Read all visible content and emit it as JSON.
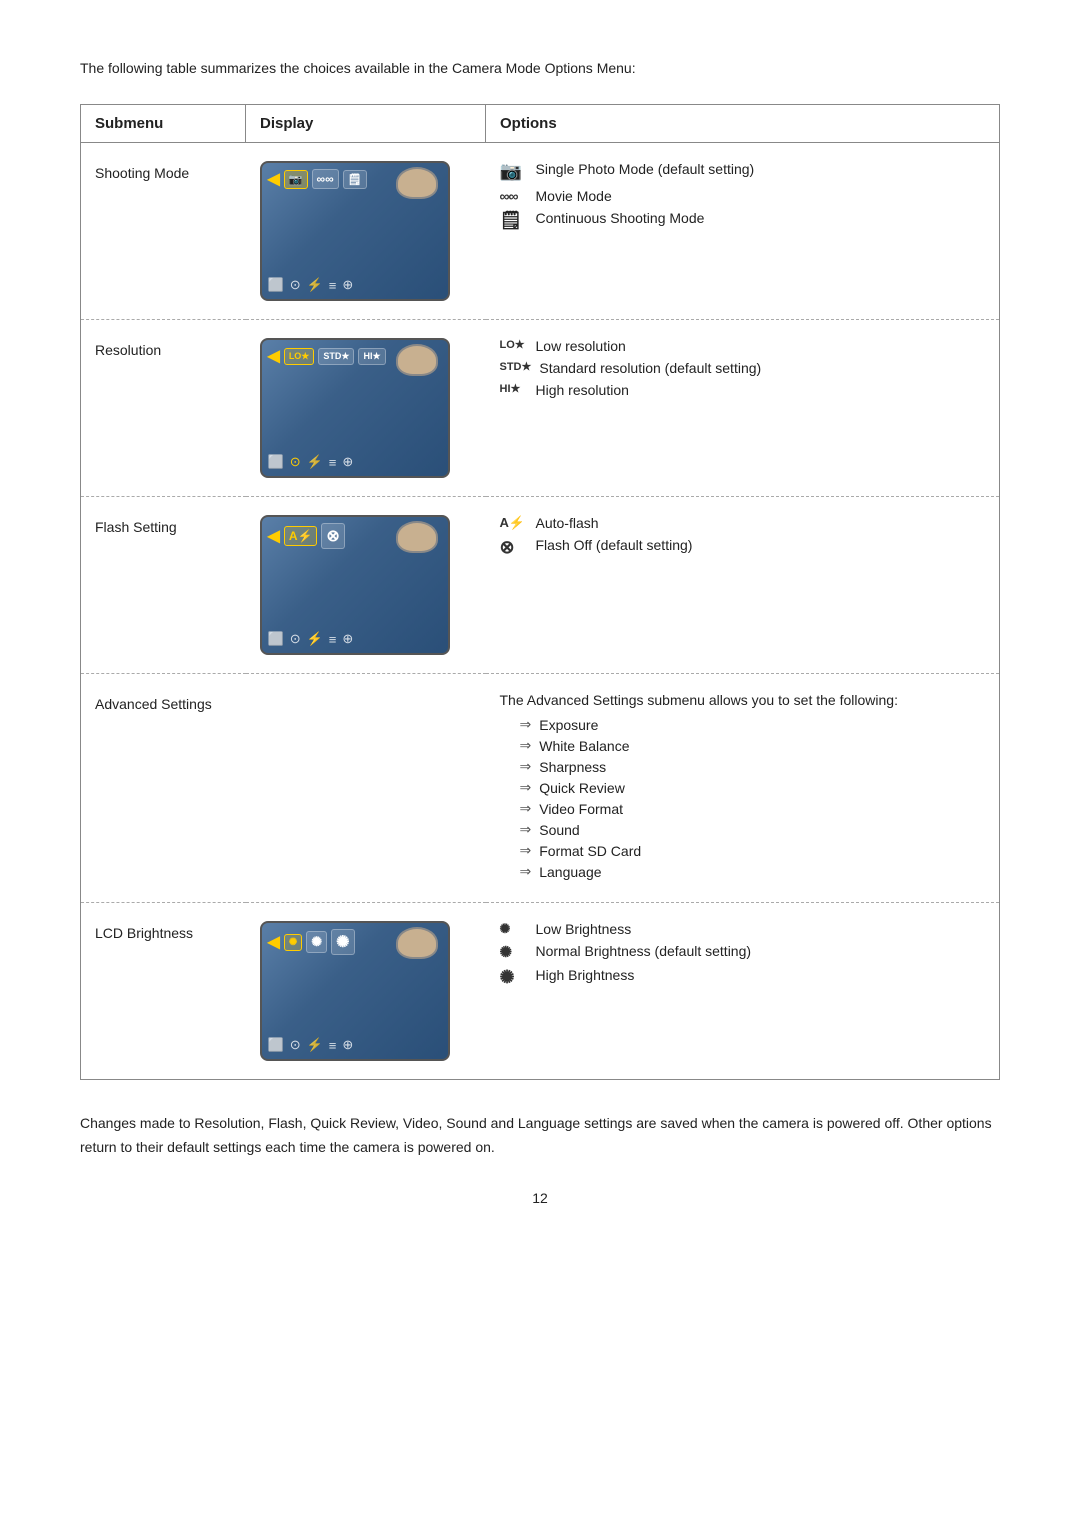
{
  "intro": "The following table summarizes the choices available in the Camera Mode Options Menu:",
  "table": {
    "headers": [
      "Submenu",
      "Display",
      "Options"
    ],
    "rows": [
      {
        "submenu": "Shooting Mode",
        "options": [
          {
            "icon": "📷",
            "iconLabel": "camera-single-icon",
            "text": "Single Photo Mode (default setting)"
          },
          {
            "icon": "∞",
            "iconLabel": "movie-mode-icon",
            "text": "Movie Mode"
          },
          {
            "icon": "⛉",
            "iconLabel": "continuous-mode-icon",
            "text": "Continuous Shooting Mode"
          }
        ]
      },
      {
        "submenu": "Resolution",
        "options": [
          {
            "icon": "LO★",
            "iconLabel": "low-res-icon",
            "text": "Low resolution"
          },
          {
            "icon": "STD★",
            "iconLabel": "std-res-icon",
            "text": "Standard resolution (default setting)"
          },
          {
            "icon": "HI★",
            "iconLabel": "hi-res-icon",
            "text": "High resolution"
          }
        ]
      },
      {
        "submenu": "Flash Setting",
        "options": [
          {
            "icon": "A⚡",
            "iconLabel": "auto-flash-icon",
            "text": "Auto-flash"
          },
          {
            "icon": "⊗",
            "iconLabel": "flash-off-icon",
            "text": "Flash Off (default setting)"
          }
        ]
      },
      {
        "submenu": "Advanced Settings",
        "advancedIntro": "The Advanced Settings submenu allows you to set the following:",
        "advancedItems": [
          "Exposure",
          "White Balance",
          "Sharpness",
          "Quick Review",
          "Video Format",
          "Sound",
          "Format SD Card",
          "Language"
        ]
      },
      {
        "submenu": "LCD Brightness",
        "options": [
          {
            "icon": "☼",
            "iconLabel": "low-brightness-icon",
            "text": "Low Brightness"
          },
          {
            "icon": "☼",
            "iconLabel": "normal-brightness-icon",
            "text": "Normal Brightness (default setting)"
          },
          {
            "icon": "☼",
            "iconLabel": "high-brightness-icon",
            "text": "High Brightness"
          }
        ]
      }
    ]
  },
  "footer": "Changes made to Resolution, Flash, Quick Review, Video, Sound and Language settings are saved when the camera is powered off. Other options return to their default settings each time the camera is powered on.",
  "pageNumber": "12"
}
